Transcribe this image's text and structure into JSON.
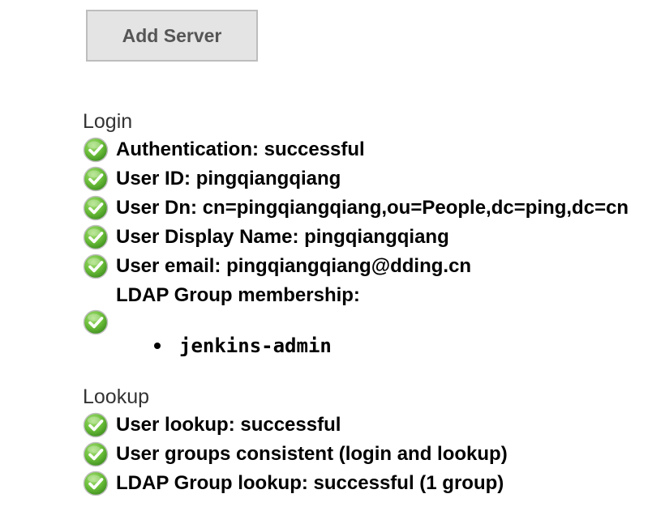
{
  "toolbar": {
    "add_server_label": "Add Server"
  },
  "login": {
    "heading": "Login",
    "items": [
      "Authentication: successful",
      "User ID: pingqiangqiang",
      "User Dn: cn=pingqiangqiang,ou=People,dc=ping,dc=cn",
      "User Display Name: pingqiangqiang",
      "User email: pingqiangqiang@dding.cn"
    ],
    "group_membership": {
      "label": "LDAP Group membership:",
      "groups": [
        "jenkins-admin"
      ]
    }
  },
  "lookup": {
    "heading": "Lookup",
    "items": [
      "User lookup: successful",
      "User groups consistent (login and lookup)",
      "LDAP Group lookup: successful (1 group)"
    ]
  },
  "icons": {
    "status": "check-circle-icon"
  },
  "colors": {
    "success_green": "#6cbf3a",
    "button_bg": "#e4e4e4"
  }
}
